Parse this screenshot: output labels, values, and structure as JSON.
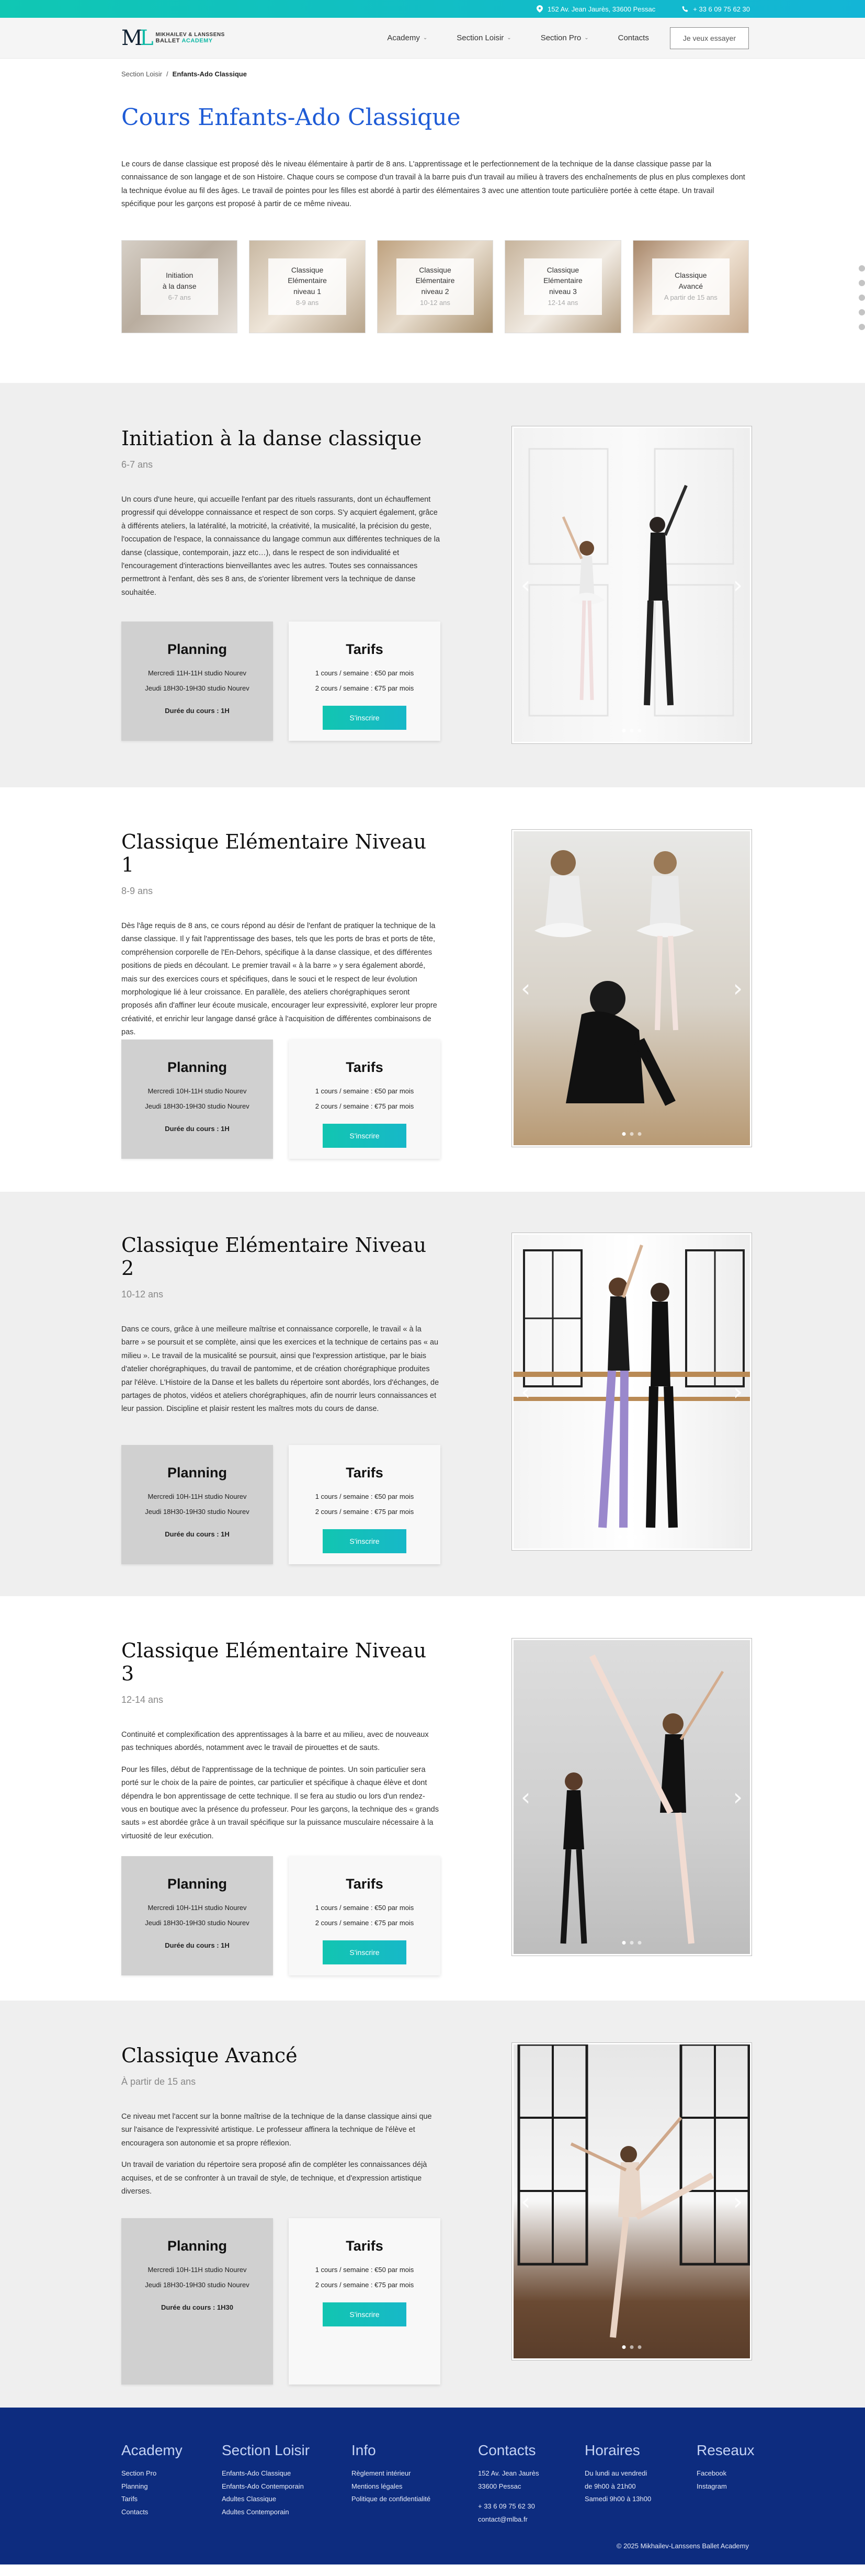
{
  "topbar": {
    "address": "152 Av. Jean Jaurès, 33600 Pessac",
    "phone": "+ 33 6 09 75 62 30"
  },
  "header": {
    "logo_line1": "MIKHAILEV & LANSSENS",
    "logo_line2a": "BALLET",
    "logo_line2b": "ACADEMY",
    "nav": [
      "Academy",
      "Section Loisir",
      "Section Pro",
      "Contacts"
    ],
    "cta": "Je veux essayer"
  },
  "breadcrumb": {
    "parent": "Section Loisir",
    "sep": "/",
    "current": "Enfants-Ado Classique"
  },
  "hero": {
    "title": "Cours Enfants-Ado Classique",
    "intro": "Le cours de danse classique est proposé dès le niveau élémentaire à partir de 8 ans. L'apprentissage et le perfectionnement de la technique de la danse classique passe par la connaissance de son langage et de son Histoire. Chaque cours se compose d'un travail à la barre puis d'un travail au milieu à travers des enchaînements de plus en plus complexes dont la technique évolue au fil des âges. Le travail de pointes pour les filles est abordé à partir des élémentaires 3 avec une attention toute particulière portée à cette étape. Un travail spécifique pour les garçons est proposé à partir de ce même niveau."
  },
  "cards": [
    {
      "l1": "Initiation",
      "l2": "à la danse",
      "l3": "",
      "age": "6-7 ans"
    },
    {
      "l1": "Classique",
      "l2": "Elémentaire",
      "l3": "niveau 1",
      "age": "8-9 ans"
    },
    {
      "l1": "Classique",
      "l2": "Elémentaire",
      "l3": "niveau 2",
      "age": "10-12 ans"
    },
    {
      "l1": "Classique",
      "l2": "Elémentaire",
      "l3": "niveau 3",
      "age": "12-14 ans"
    },
    {
      "l1": "Classique",
      "l2": "Avancé",
      "l3": "",
      "age": "A partir de 15 ans"
    }
  ],
  "sections": [
    {
      "title": "Initiation à la danse classique",
      "age": "6-7 ans",
      "paragraphs": [
        "Un cours d'une heure, qui accueille l'enfant par des rituels rassurants, dont un échauffement progressif qui développe connaissance et respect de son corps. S'y acquiert également, grâce à différents ateliers, la latéralité, la motricité, la créativité, la musicalité, la précision du geste, l'occupation de l'espace, la connaissance du langage commun aux différentes techniques de la danse (classique, contemporain, jazz etc…), dans le respect de son individualité et l'encouragement d'interactions bienveillantes avec les autres. Toutes ses connaissances permettront à l'enfant, dès ses 8 ans, de s'orienter librement vers la technique de danse souhaitée."
      ],
      "planning": {
        "title": "Planning",
        "l1": "Mercredi 11H-11H studio Nourev",
        "l2": "Jeudi 18H30-19H30 studio Nourev",
        "dur": "Durée du cours : 1H"
      },
      "tarifs": {
        "title": "Tarifs",
        "l1": "1 cours / semaine : €50 par mois",
        "l2": "2 cours / semaine : €75 par mois",
        "btn": "S'inscrire"
      }
    },
    {
      "title": "Classique Elémentaire Niveau 1",
      "age": "8-9 ans",
      "paragraphs": [
        "Dès l'âge requis de 8 ans, ce cours répond au désir de l'enfant de pratiquer la technique de la danse classique. Il y fait l'apprentissage des bases, tels que les ports de bras et ports de tête, compréhension corporelle de l'En-Dehors, spécifique à la danse classique, et des différentes positions de pieds en découlant. Le premier travail « à la barre » y sera également abordé, mais sur des exercices cours et spécifiques, dans le souci et le respect de leur évolution morphologique lié à leur croissance. En parallèle, des ateliers chorégraphiques seront proposés afin d'affiner leur écoute musicale, encourager leur expressivité, explorer leur propre créativité, et enrichir leur langage dansé grâce à l'acquisition de différentes combinaisons de pas."
      ],
      "planning": {
        "title": "Planning",
        "l1": "Mercredi 10H-11H studio Nourev",
        "l2": "Jeudi 18H30-19H30 studio Nourev",
        "dur": "Durée du cours : 1H"
      },
      "tarifs": {
        "title": "Tarifs",
        "l1": "1 cours / semaine : €50 par mois",
        "l2": "2 cours / semaine : €75 par mois",
        "btn": "S'inscrire"
      }
    },
    {
      "title": "Classique Elémentaire Niveau 2",
      "age": "10-12 ans",
      "paragraphs": [
        "Dans ce cours, grâce à une meilleure maîtrise et connaissance corporelle, le travail « à la barre » se poursuit et se complète, ainsi que les exercices et la technique de certains pas « au milieu ». Le travail de la musicalité se poursuit, ainsi que l'expression artistique, par le biais d'atelier chorégraphiques, du travail de pantomime, et de création chorégraphique produites par l'élève. L'Histoire de la Danse et les ballets du répertoire sont abordés, lors d'échanges, de partages de photos, vidéos et ateliers chorégraphiques, afin de nourrir leurs connaissances et leur passion. Discipline et plaisir restent les maîtres mots du cours de danse."
      ],
      "planning": {
        "title": "Planning",
        "l1": "Mercredi 10H-11H studio Nourev",
        "l2": "Jeudi 18H30-19H30 studio Nourev",
        "dur": "Durée du cours : 1H"
      },
      "tarifs": {
        "title": "Tarifs",
        "l1": "1 cours / semaine : €50 par mois",
        "l2": "2 cours / semaine : €75 par mois",
        "btn": "S'inscrire"
      }
    },
    {
      "title": "Classique Elémentaire Niveau 3",
      "age": "12-14 ans",
      "paragraphs": [
        "Continuité et complexification des apprentissages à la barre et au milieu, avec de nouveaux pas techniques abordés, notamment avec le travail de pirouettes et de sauts.",
        "Pour les filles, début de l'apprentissage de la technique de pointes. Un soin particulier sera porté sur le choix de la paire de pointes, car particulier et spécifique à chaque élève et dont dépendra le bon apprentissage de cette technique. Il se fera au studio ou lors d'un rendez- vous en boutique avec la présence du professeur. Pour les garçons, la technique des « grands sauts » est abordée grâce à un travail spécifique sur la puissance musculaire nécessaire à la virtuosité de leur exécution."
      ],
      "planning": {
        "title": "Planning",
        "l1": "Mercredi 10H-11H studio Nourev",
        "l2": "Jeudi 18H30-19H30 studio Nourev",
        "dur": "Durée du cours : 1H"
      },
      "tarifs": {
        "title": "Tarifs",
        "l1": "1 cours / semaine : €50 par mois",
        "l2": "2 cours / semaine : €75 par mois",
        "btn": "S'inscrire"
      }
    },
    {
      "title": "Classique Avancé",
      "age": "À partir de 15 ans",
      "paragraphs": [
        "Ce niveau met l'accent sur la bonne maîtrise de la technique de la danse classique ainsi que sur l'aisance de l'expressivité artistique. Le professeur affinera la technique de l'élève et encouragera son autonomie et sa propre réflexion.",
        "Un travail de variation du répertoire sera proposé afin de compléter les connaissances déjà acquises, et de se confronter à un travail de style, de technique, et d'expression artistique diverses."
      ],
      "planning": {
        "title": "Planning",
        "l1": "Mercredi 10H-11H studio Nourev",
        "l2": "Jeudi 18H30-19H30 studio Nourev",
        "dur": "Durée du cours : 1H30"
      },
      "tarifs": {
        "title": "Tarifs",
        "l1": "1 cours / semaine : €50 par mois",
        "l2": "2 cours / semaine : €75 par mois",
        "btn": "S'inscrire"
      }
    }
  ],
  "footer": {
    "cols": [
      {
        "title": "Academy",
        "links": [
          "Section Pro",
          "Planning",
          "Tarifs",
          "Contacts"
        ]
      },
      {
        "title": "Section Loisir",
        "links": [
          "Enfants-Ado Classique",
          "Enfants-Ado Contemporain",
          "Adultes Classique",
          "Adultes Contemporain"
        ]
      },
      {
        "title": "Info",
        "links": [
          "Règlement intérieur",
          "Mentions légales",
          "Politique de confidentialité"
        ]
      },
      {
        "title": "Contacts",
        "links": [
          "152 Av. Jean Jaurès",
          "33600 Pessac",
          "",
          "+ 33 6 09 75 62 30",
          "contact@mlba.fr"
        ]
      },
      {
        "title": "Horaires",
        "links": [
          "Du lundi au vendredi",
          "de 9h00 à 21h00",
          "Samedi 9h00 à 13h00"
        ]
      },
      {
        "title": "Reseaux",
        "links": [
          "Facebook",
          "Instagram"
        ]
      }
    ],
    "copyright": "© 2025 Mikhailev-Lanssens Ballet Academy"
  }
}
